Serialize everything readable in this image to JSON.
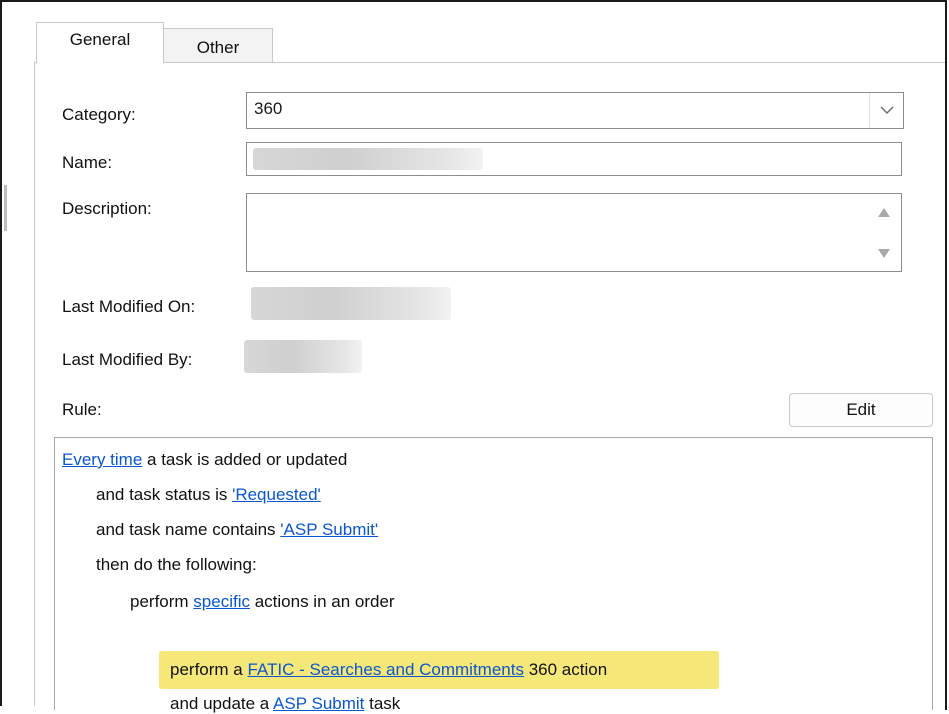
{
  "tabs": [
    {
      "label": "General",
      "active": true
    },
    {
      "label": "Other",
      "active": false
    }
  ],
  "form": {
    "category_label": "Category:",
    "category_value": "360",
    "name_label": "Name:",
    "description_label": "Description:",
    "last_modified_on_label": "Last Modified On:",
    "last_modified_by_label": "Last Modified By:",
    "rule_label": "Rule:",
    "edit_label": "Edit"
  },
  "icons": {
    "dropdown": "chevron-down-icon",
    "scroll_up": "scroll-up-arrow-icon",
    "scroll_down": "scroll-down-arrow-icon"
  },
  "rule": {
    "line1": {
      "link": "Every time",
      "text": " a task is added or updated"
    },
    "line2": {
      "text": "and task status is ",
      "link": "'Requested'"
    },
    "line3": {
      "text": "and task name contains ",
      "link": "'ASP Submit'"
    },
    "line4": {
      "text": "then do the following:"
    },
    "line5": {
      "text_before": "perform ",
      "link": "specific",
      "text_after": " actions in an order"
    },
    "line6": {
      "text_before": "perform a ",
      "link": "FATIC - Searches and Commitments",
      "text_after": " 360 action"
    },
    "line7": {
      "text_before": "and update a ",
      "link": "ASP Submit",
      "text_after": " task"
    }
  },
  "colors": {
    "link": "#0a57d0",
    "highlight": "#f6e779"
  }
}
